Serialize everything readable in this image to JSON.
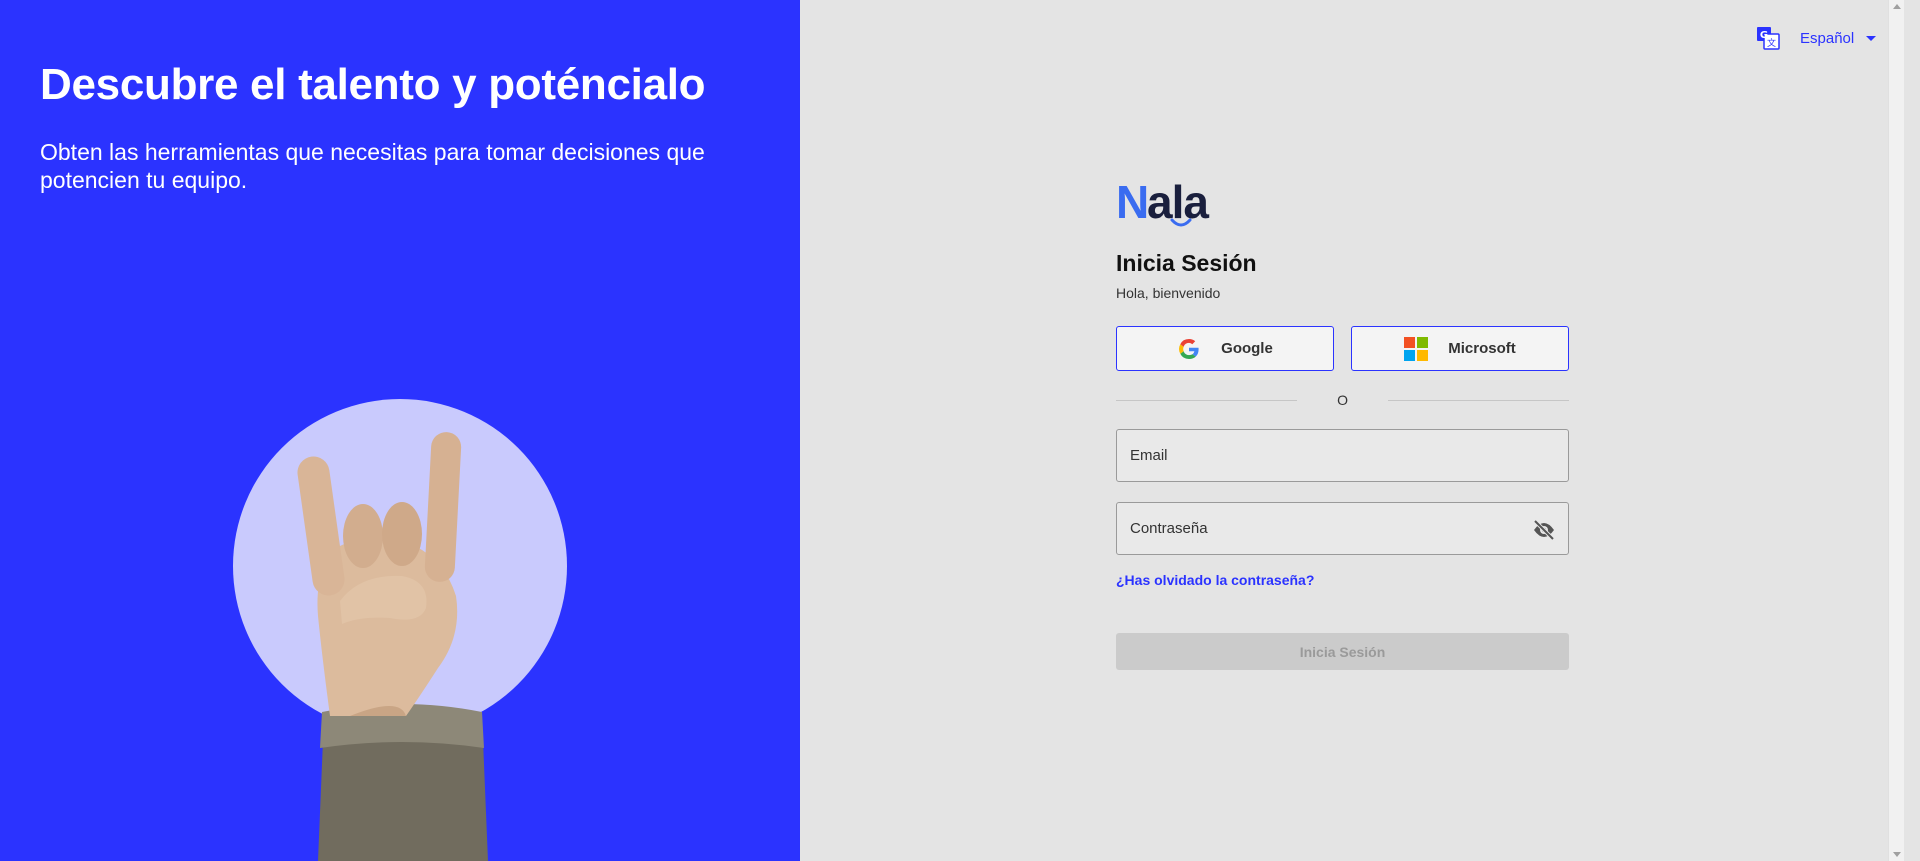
{
  "hero": {
    "title": "Descubre el talento y poténcialo",
    "subtitle": "Obten las herramientas que necesitas para tomar decisiones que potencien tu equipo."
  },
  "language": {
    "icon": "translate-icon",
    "selected": "Español"
  },
  "brand": {
    "logo": "Nala",
    "accent": "#2b33ff",
    "logo_dark": "#1a1f3d",
    "logo_blue": "#3a6cf0"
  },
  "login": {
    "title": "Inicia Sesión",
    "subtitle": "Hola, bienvenido",
    "google_label": "Google",
    "microsoft_label": "Microsoft",
    "divider": "O",
    "email_placeholder": "Email",
    "password_placeholder": "Contraseña",
    "password_toggle_icon": "eye-off-icon",
    "forgot_password": "¿Has olvidado la contraseña?",
    "submit_label": "Inicia Sesión"
  }
}
